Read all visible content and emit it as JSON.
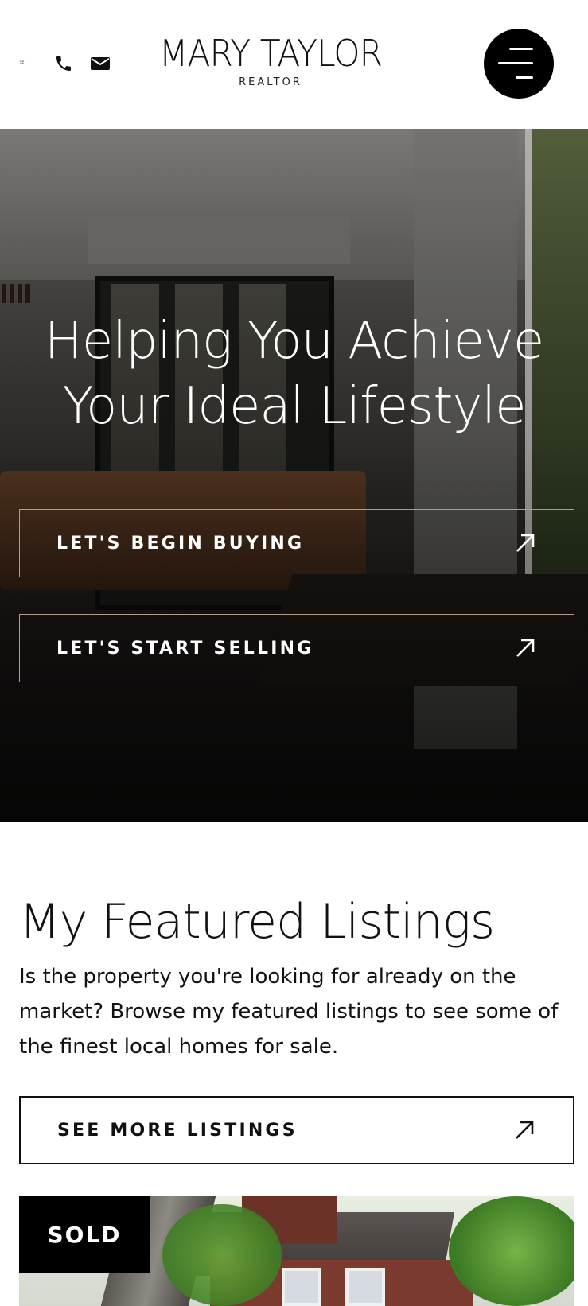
{
  "header": {
    "tiny_mark": "⌘",
    "phone_icon": "phone-icon",
    "mail_icon": "envelope-icon",
    "brand_name": "MARY TAYLOR",
    "brand_sub": "REALTOR",
    "menu_icon": "hamburger-menu-icon"
  },
  "hero": {
    "title_line1": "Helping You Achieve",
    "title_line2": "Your Ideal Lifestyle",
    "buy_label": "LET'S BEGIN BUYING",
    "sell_label": "LET'S START SELLING",
    "arrow_icon": "arrow-up-right-icon"
  },
  "featured": {
    "title": "My Featured Listings",
    "description": "Is the property you're looking for already on the market? Browse my featured listings to see some of the finest local homes for sale.",
    "more_label": "SEE MORE LISTINGS"
  },
  "listing": {
    "badge": "SOLD"
  },
  "colors": {
    "accent_border": "#b99a86",
    "menu_bg": "#000000",
    "text": "#111111"
  }
}
